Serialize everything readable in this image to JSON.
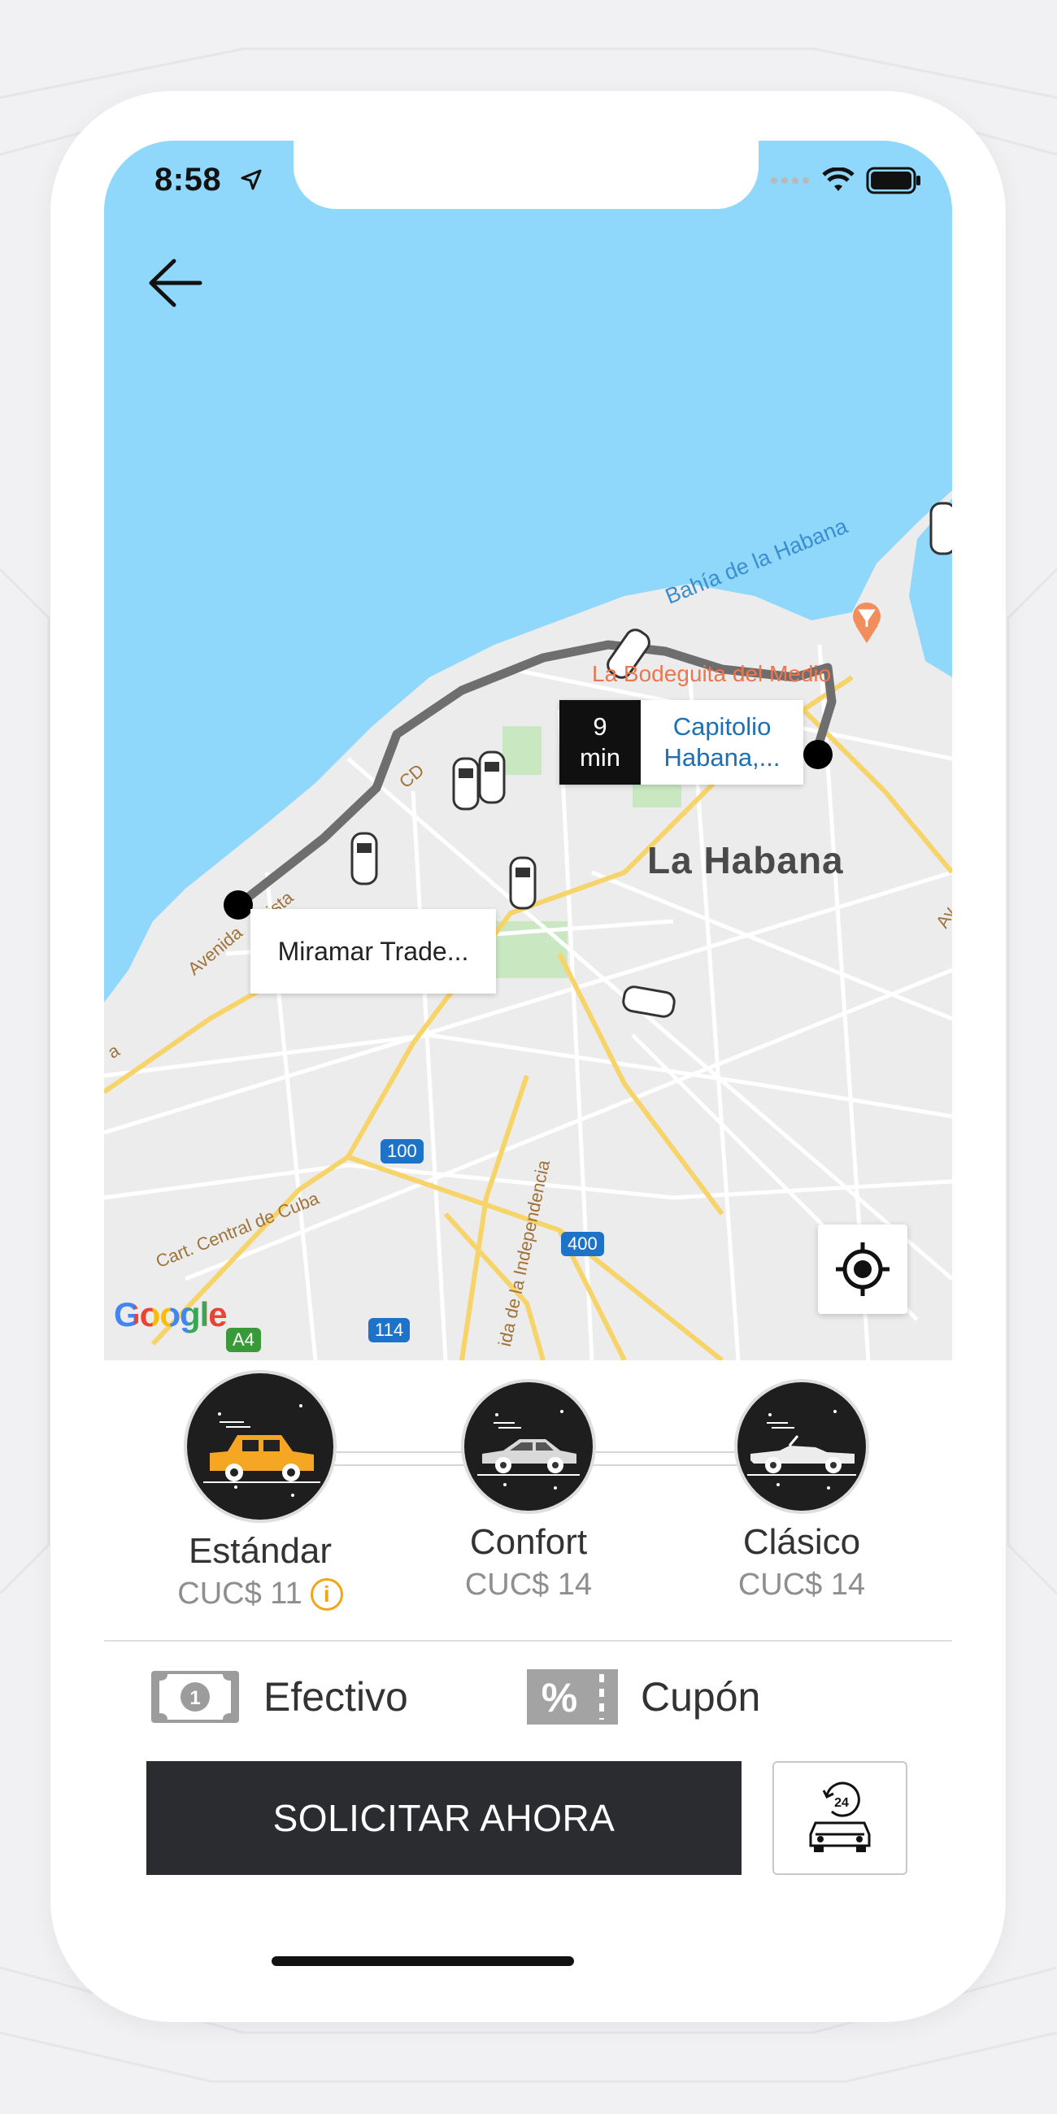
{
  "status_bar": {
    "time": "8:58"
  },
  "map": {
    "bay_label": "Bahía de la Habana",
    "city_label": "La Habana",
    "poi_label": "La Bodeguita del Medio",
    "road_labels": [
      "Avenida",
      "ista",
      "Cart. Central de Cuba",
      "ida de la Independencia",
      "a",
      "CD",
      "Av"
    ],
    "route_badges": [
      "100",
      "400",
      "114",
      "A4"
    ],
    "google_logo": "Google",
    "eta": {
      "value": "9",
      "unit": "min"
    },
    "destination": {
      "line1": "Capitolio",
      "line2": "Habana,..."
    },
    "origin": "Miramar Trade..."
  },
  "services": [
    {
      "name": "Estándar",
      "price": "CUC$ 11",
      "selected": true,
      "has_info": true,
      "info_symbol": "i"
    },
    {
      "name": "Confort",
      "price": "CUC$ 14",
      "selected": false,
      "has_info": false
    },
    {
      "name": "Clásico",
      "price": "CUC$ 14",
      "selected": false,
      "has_info": false
    }
  ],
  "payment": {
    "cash_label": "Efectivo",
    "cash_icon_text": "1",
    "coupon_label": "Cupón",
    "coupon_icon_text": "%"
  },
  "actions": {
    "request_label": "SOLICITAR AHORA",
    "schedule_icon_text": "24"
  },
  "colors": {
    "water": "#8fd8fb",
    "land": "#ececec",
    "route": "#6e6e6e",
    "button_dark": "#2a2c2f",
    "accent_orange": "#f0a51a",
    "link_blue": "#1f6fb3"
  }
}
